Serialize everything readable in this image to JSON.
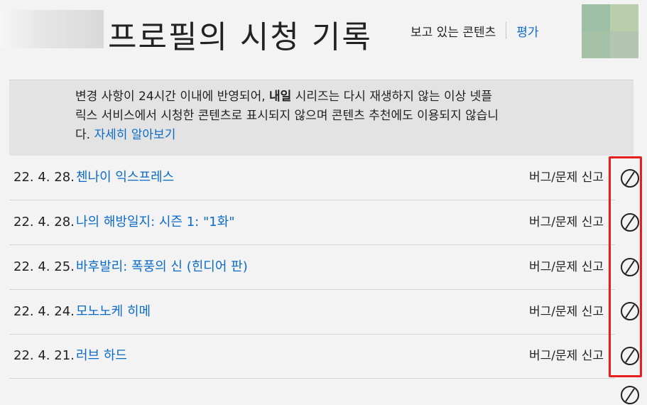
{
  "header": {
    "title": "프로필의 시청 기록",
    "nav_viewing": "보고 있는 콘텐츠",
    "nav_ratings": "평가"
  },
  "notice": {
    "text_before": "변경 사항이 24시간 이내에 반영되어, ",
    "text_bold": "내일",
    "text_after": " 시리즈는 다시 재생하지 않는 이상 넷플릭스 서비스에서 시청한 콘텐츠로 표시되지 않으며 콘텐츠 추천에도 이용되지 않습니다. ",
    "link": "자세히 알아보기"
  },
  "history": [
    {
      "date": "22. 4. 28.",
      "title": "첸나이 익스프레스",
      "report": "버그/문제 신고",
      "icon": "hide-from-history-icon"
    },
    {
      "date": "22. 4. 28.",
      "title": "나의 해방일지: 시즌 1: \"1화\"",
      "report": "버그/문제 신고",
      "icon": "hide-from-history-icon"
    },
    {
      "date": "22. 4. 25.",
      "title": "바후발리: 폭풍의 신 (힌디어 판)",
      "report": "버그/문제 신고",
      "icon": "hide-from-history-icon"
    },
    {
      "date": "22. 4. 24.",
      "title": "모노노케 히메",
      "report": "버그/문제 신고",
      "icon": "hide-from-history-icon"
    },
    {
      "date": "22. 4. 21.",
      "title": "러브 하드",
      "report": "버그/문제 신고",
      "icon": "hide-from-history-icon"
    }
  ],
  "colors": {
    "link": "#0b6bc9",
    "highlight": "#e81e1e",
    "background": "#f3f3f3",
    "notice_bg": "#e3e3e3"
  }
}
